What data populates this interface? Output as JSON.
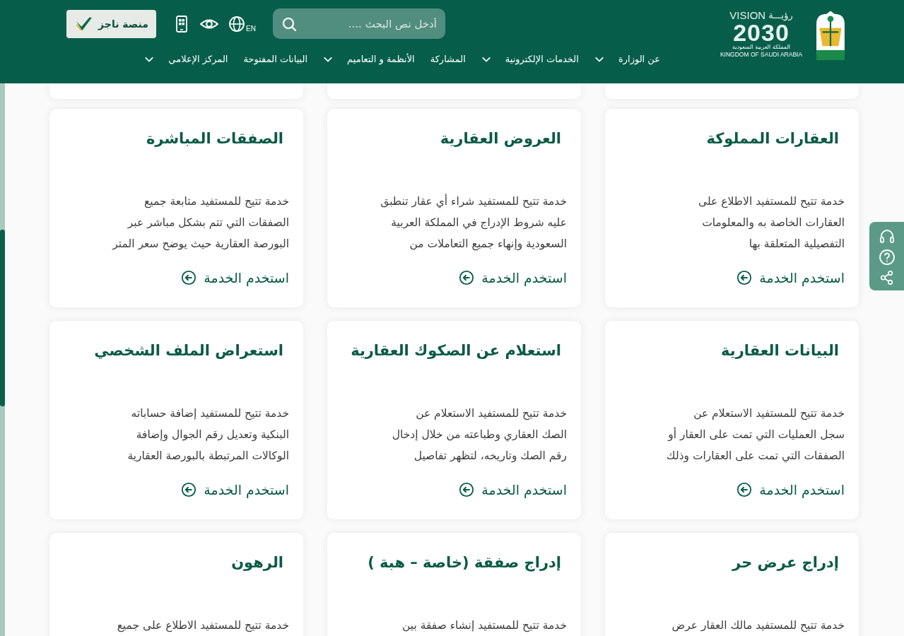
{
  "header": {
    "logo": {
      "vision_word_en": "VISION",
      "vision_word_ar": "رؤيـــة",
      "year": "2030",
      "country_ar": "المملكة العربية السعودية",
      "country_en": "KINGDOM OF SAUDI ARABIA"
    },
    "search": {
      "placeholder": "أدخل نص البحث ...."
    },
    "language": "EN",
    "najiz_button": "منصة ناجز",
    "nav": [
      {
        "label": "عن الوزارة",
        "dropdown": true
      },
      {
        "label": "الخدمات الإلكترونية",
        "dropdown": true
      },
      {
        "label": "المشاركة",
        "dropdown": false
      },
      {
        "label": "الأنظمة و التعاميم",
        "dropdown": true
      },
      {
        "label": "البيانات المفتوحة",
        "dropdown": false
      },
      {
        "label": "المركز الإعلامي",
        "dropdown": true
      }
    ]
  },
  "services": [
    {
      "title": "العقارات المملوكة",
      "description_lines": [
        "خدمة تتيح للمستفيد الاطلاع على",
        "العقارات الخاصة به والمعلومات",
        "التفصيلية المتعلقة بها"
      ],
      "link": "استخدم الخدمة"
    },
    {
      "title": "العروض العقارية",
      "description_lines": [
        "خدمة تتيح للمستفيد شراء أي عقار تنطبق",
        "عليه شروط الإدراج في المملكة العربية",
        "السعودية وإنهاء جميع التعاملات من"
      ],
      "link": "استخدم الخدمة"
    },
    {
      "title": "الصفقات المباشرة",
      "description_lines": [
        "خدمة تتيح للمستفيد متابعة جميع",
        "الصفقات التي تتم بشكل مباشر عبر",
        "البورصة العقارية حيث يوضح سعر المتر"
      ],
      "link": "استخدم الخدمة"
    },
    {
      "title": "البيانات العقارية",
      "description_lines": [
        "خدمة تتيح للمستفيد الاستعلام عن",
        "سجل العمليات التي تمت على العقار أو",
        "الصفقات التي تمت على العقارات وذلك"
      ],
      "link": "استخدم الخدمة"
    },
    {
      "title": "استعلام عن الصكوك العقارية",
      "description_lines": [
        "خدمة تتيح للمستفيد الاستعلام عن",
        "الصك العقاري وطباعته من خلال إدخال",
        "رقم الصك وتاريخه، لتظهر تفاصيل"
      ],
      "link": "استخدم الخدمة"
    },
    {
      "title": "استعراض الملف الشخصي",
      "description_lines": [
        "خدمة تتيح للمستفيد إضافة حساباته",
        "البنكية وتعديل رقم الجوال وإضافة",
        "الوكالات المرتبطة بالبورصة العقارية"
      ],
      "link": "استخدم الخدمة"
    },
    {
      "title": "إدراج عرض حر",
      "description_lines": [
        "خدمة تتيح للمستفيد مالك العقار عرض"
      ]
    },
    {
      "title": "إدراج صفقة (خاصة – هبة )",
      "description_lines": [
        "خدمة تتيح للمستفيد إنشاء صفقة بين"
      ]
    },
    {
      "title": "الرهون",
      "description_lines": [
        "خدمة تتيح للمستفيد الاطلاع على جميع"
      ]
    }
  ]
}
